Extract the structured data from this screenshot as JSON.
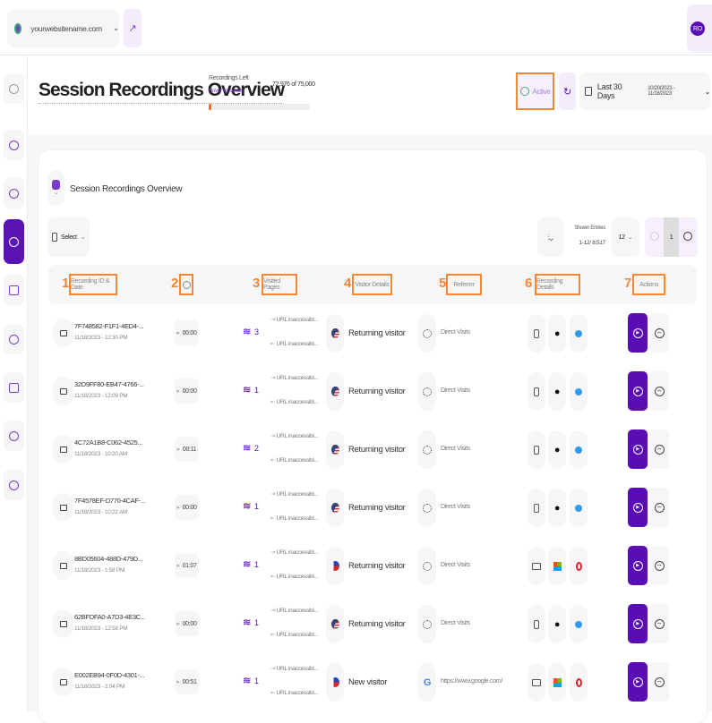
{
  "topbar": {
    "website": "yourwebsitename.com",
    "avatar_initials": "RO"
  },
  "header": {
    "title": "Session Recordings Overview",
    "recordings_left_label": "Recordings Left",
    "hover_label": "Hover for details",
    "recordings_count": "72,976 of 75,000",
    "recordings_used_fraction": 0.027,
    "status_label": "Active",
    "date_range_label": "Last 30 Days",
    "date_range": "10/20/2023 - 11/18/2023"
  },
  "card": {
    "title": "Session Recordings Overview",
    "select_label": "Select",
    "shown_entries_label": "Shown Entries",
    "shown_entries_value": "1-12/ 8,517",
    "per_page": "12",
    "current_page": "1"
  },
  "columns": [
    {
      "num": "1",
      "label": "Recording ID & Date"
    },
    {
      "num": "2",
      "label": ""
    },
    {
      "num": "3",
      "label": "Visited Pages"
    },
    {
      "num": "4",
      "label": "Visitor Details"
    },
    {
      "num": "5",
      "label": "Referrer"
    },
    {
      "num": "6",
      "label": "Recording Details"
    },
    {
      "num": "7",
      "label": "Actions"
    }
  ],
  "rows": [
    {
      "id": "7F748582-F1F1-4ED4-...",
      "date": "11/18/2023 - 12:30 PM",
      "duration": "00:00",
      "pages": "3",
      "entry_url": "URL inaccessibl...",
      "exit_url": "URL inaccessibl...",
      "flag": "us",
      "visitor": "Returning visitor",
      "referrer_icon": "direct",
      "referrer": "Direct Visits",
      "device": "mobile",
      "os": "apple",
      "browser": "safari"
    },
    {
      "id": "32D9FF80-EB47-4766-...",
      "date": "11/18/2023 - 12:09 PM",
      "duration": "00:00",
      "pages": "1",
      "entry_url": "URL inaccessibl...",
      "exit_url": "URL inaccessibl...",
      "flag": "us",
      "visitor": "Returning visitor",
      "referrer_icon": "direct",
      "referrer": "Direct Visits",
      "device": "mobile",
      "os": "apple",
      "browser": "safari"
    },
    {
      "id": "4C72A1B8-C062-4525...",
      "date": "11/18/2023 - 10:20 AM",
      "duration": "00:11",
      "pages": "2",
      "entry_url": "URL inaccessibl...",
      "exit_url": "URL inaccessibl...",
      "flag": "us",
      "visitor": "Returning visitor",
      "referrer_icon": "direct",
      "referrer": "Direct Visits",
      "device": "mobile",
      "os": "apple",
      "browser": "safari"
    },
    {
      "id": "7F4578EF-D770-4CAF-...",
      "date": "11/18/2023 - 10:22 AM",
      "duration": "00:00",
      "pages": "1",
      "entry_url": "URL inaccessibl...",
      "exit_url": "URL inaccessibl...",
      "flag": "us",
      "visitor": "Returning visitor",
      "referrer_icon": "direct",
      "referrer": "Direct Visits",
      "device": "mobile",
      "os": "apple",
      "browser": "safari"
    },
    {
      "id": "8BD05604-488D-479D...",
      "date": "11/18/2023 - 1:58 PM",
      "duration": "01:07",
      "pages": "1",
      "entry_url": "URL inaccessibl...",
      "exit_url": "URL inaccessibl...",
      "flag": "ph",
      "visitor": "Returning visitor",
      "referrer_icon": "direct",
      "referrer": "Direct Visits",
      "device": "desktop",
      "os": "windows",
      "browser": "opera"
    },
    {
      "id": "62BFDFA0-A7D3-4E3C...",
      "date": "11/18/2023 - 12:58 PM",
      "duration": "00:00",
      "pages": "1",
      "entry_url": "URL inaccessibl...",
      "exit_url": "URL inaccessibl...",
      "flag": "us",
      "visitor": "Returning visitor",
      "referrer_icon": "direct",
      "referrer": "Direct Visits",
      "device": "mobile",
      "os": "apple",
      "browser": "safari"
    },
    {
      "id": "E002EB94-0F0D-4301-...",
      "date": "11/18/2023 - 2:04 PM",
      "duration": "00:51",
      "pages": "1",
      "entry_url": "URL inaccessibl...",
      "exit_url": "URL inaccessibl...",
      "flag": "ph",
      "visitor": "New visitor",
      "referrer_icon": "google",
      "referrer": "https://www.google.com/",
      "device": "desktop",
      "os": "windows",
      "browser": "opera"
    }
  ],
  "colors": {
    "accent": "#5a0db4",
    "highlight": "#f58634",
    "progress": "#f26b2a"
  }
}
